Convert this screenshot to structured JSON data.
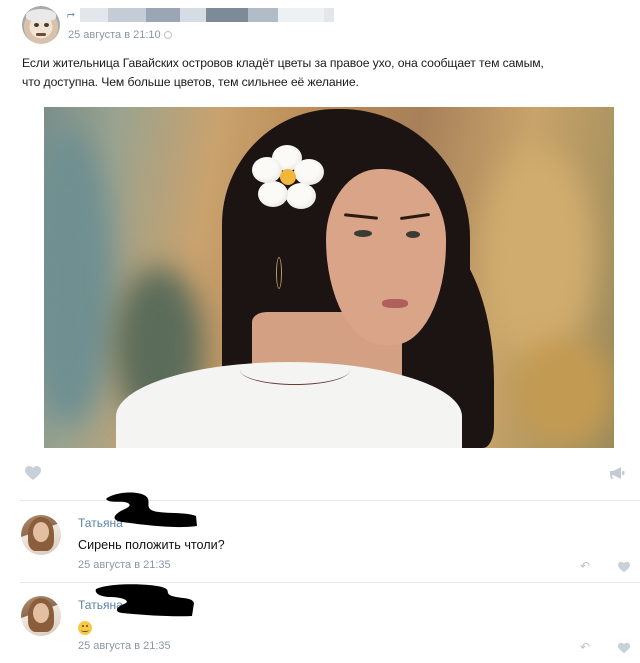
{
  "post": {
    "date": "25 августа в 21:10",
    "text_line1": "Если жительница Гавайских островов кладёт цветы за правое ухо, она сообщает тем самым,",
    "text_line2": "что доступна. Чем больше цветов, тем сильнее её желание.",
    "author_redaction_colors": [
      "#e3e7ec",
      "#c4ccd5",
      "#9aa6b3",
      "#d6dce3",
      "#7d8a98",
      "#b2bcc7",
      "#eef1f4"
    ]
  },
  "comments": [
    {
      "author": "Татьяна",
      "text": "Сирень положить чтоли?",
      "date": "25 августа в 21:35"
    },
    {
      "author": "Татьяна",
      "text": "",
      "emoji": "smiling-face",
      "date": "25 августа в 21:35"
    }
  ],
  "colors": {
    "link": "#5d81a8",
    "meta": "#8a96a3",
    "icon": "#b9c2cb",
    "redaction": "#000000"
  },
  "icons": [
    "repost-icon",
    "settings-icon",
    "heart-icon",
    "megaphone-icon",
    "reply-icon",
    "emoji-icon"
  ]
}
